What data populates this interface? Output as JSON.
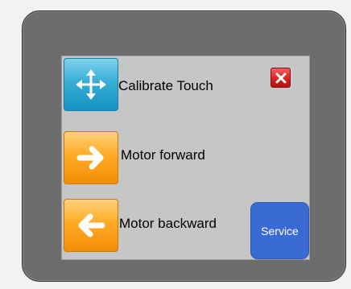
{
  "menu": {
    "items": [
      {
        "label": "Calibrate Touch",
        "icon": "move-arrows-icon",
        "color": "#36aed6"
      },
      {
        "label": "Motor forward",
        "icon": "arrow-right-icon",
        "color": "#ffab24"
      },
      {
        "label": "Motor backward",
        "icon": "arrow-left-icon",
        "color": "#ffab24"
      }
    ]
  },
  "close": {
    "icon": "close-icon",
    "color": "#d51e1e"
  },
  "service": {
    "label": "Service",
    "color": "#3a6bd3"
  }
}
